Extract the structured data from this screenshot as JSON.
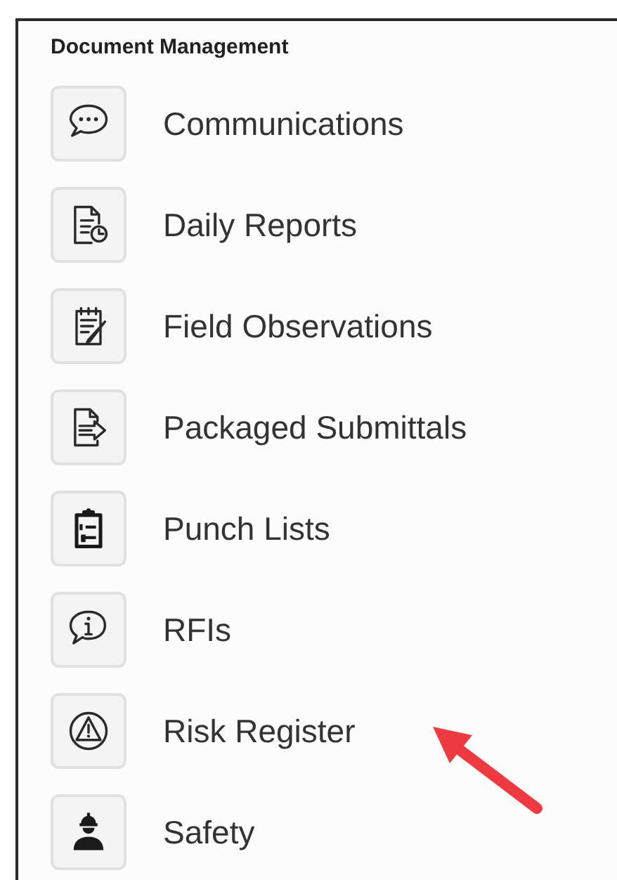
{
  "section": {
    "title": "Document Management"
  },
  "items": [
    {
      "label": "Communications",
      "pointed": false
    },
    {
      "label": "Daily Reports",
      "pointed": false
    },
    {
      "label": "Field Observations",
      "pointed": false
    },
    {
      "label": "Packaged Submittals",
      "pointed": false
    },
    {
      "label": "Punch Lists",
      "pointed": false
    },
    {
      "label": "RFIs",
      "pointed": false
    },
    {
      "label": "Risk Register",
      "pointed": true
    },
    {
      "label": "Safety",
      "pointed": false
    }
  ]
}
